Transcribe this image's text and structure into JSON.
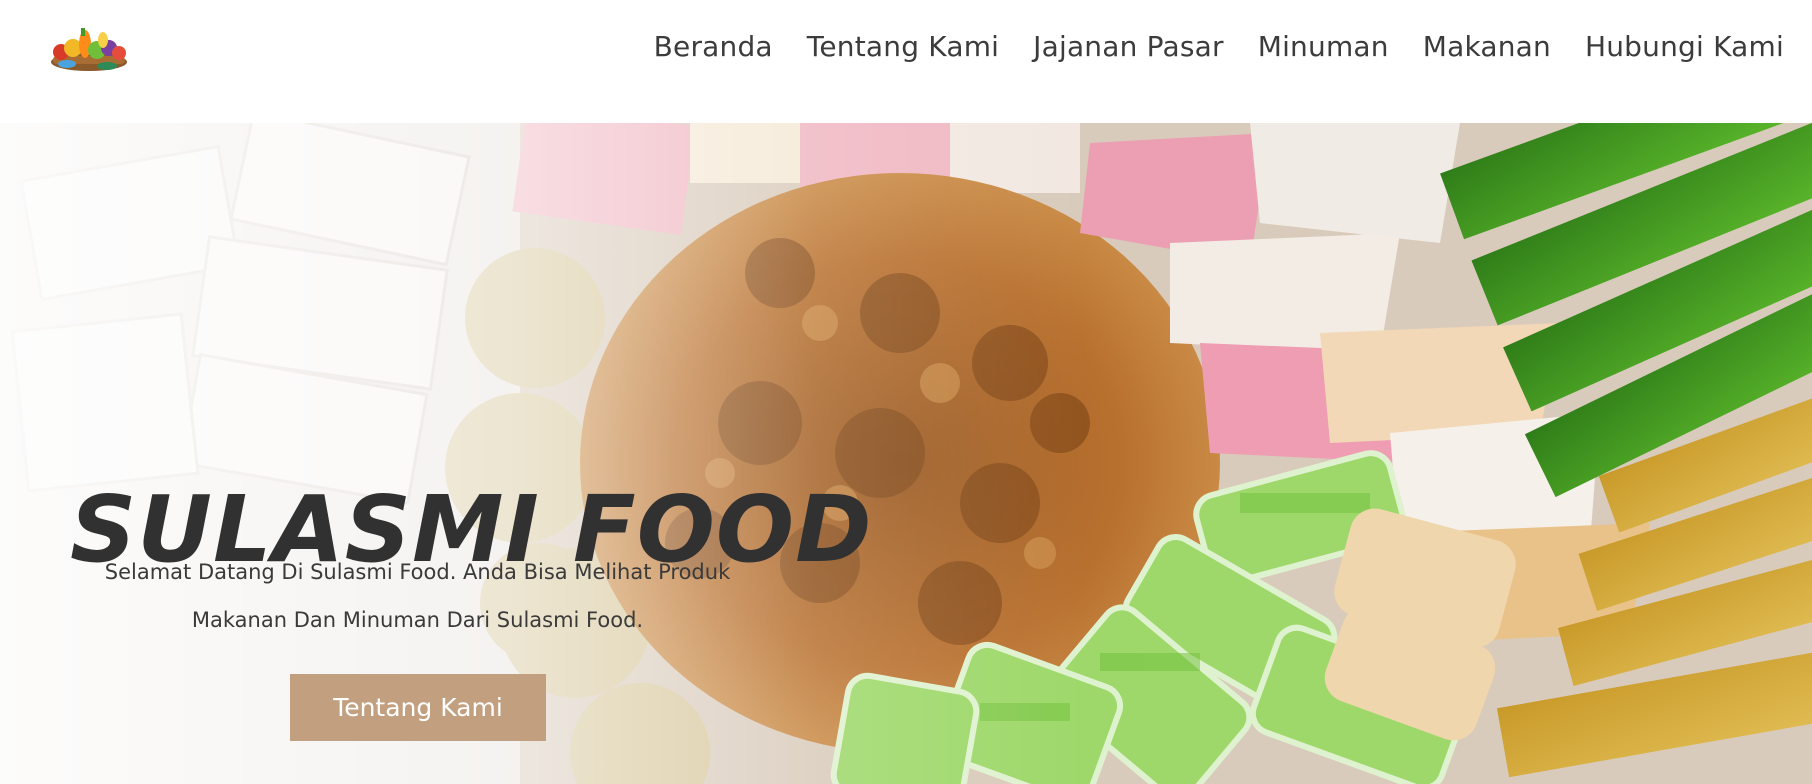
{
  "nav": {
    "links": [
      "Beranda",
      "Tentang Kami",
      "Jajanan Pasar",
      "Minuman",
      "Makanan",
      "Hubungi Kami"
    ]
  },
  "hero": {
    "title": "SULASMI FOOD",
    "subtitle_line1": "Selamat Datang Di Sulasmi Food. Anda Bisa Melihat Produk",
    "subtitle_line2": "Makanan Dan Minuman Dari Sulasmi Food.",
    "button_label": "Tentang Kami"
  },
  "colors": {
    "accent_button": "#c2a07f",
    "title_text": "#313131",
    "nav_text": "#3c3c3c"
  }
}
